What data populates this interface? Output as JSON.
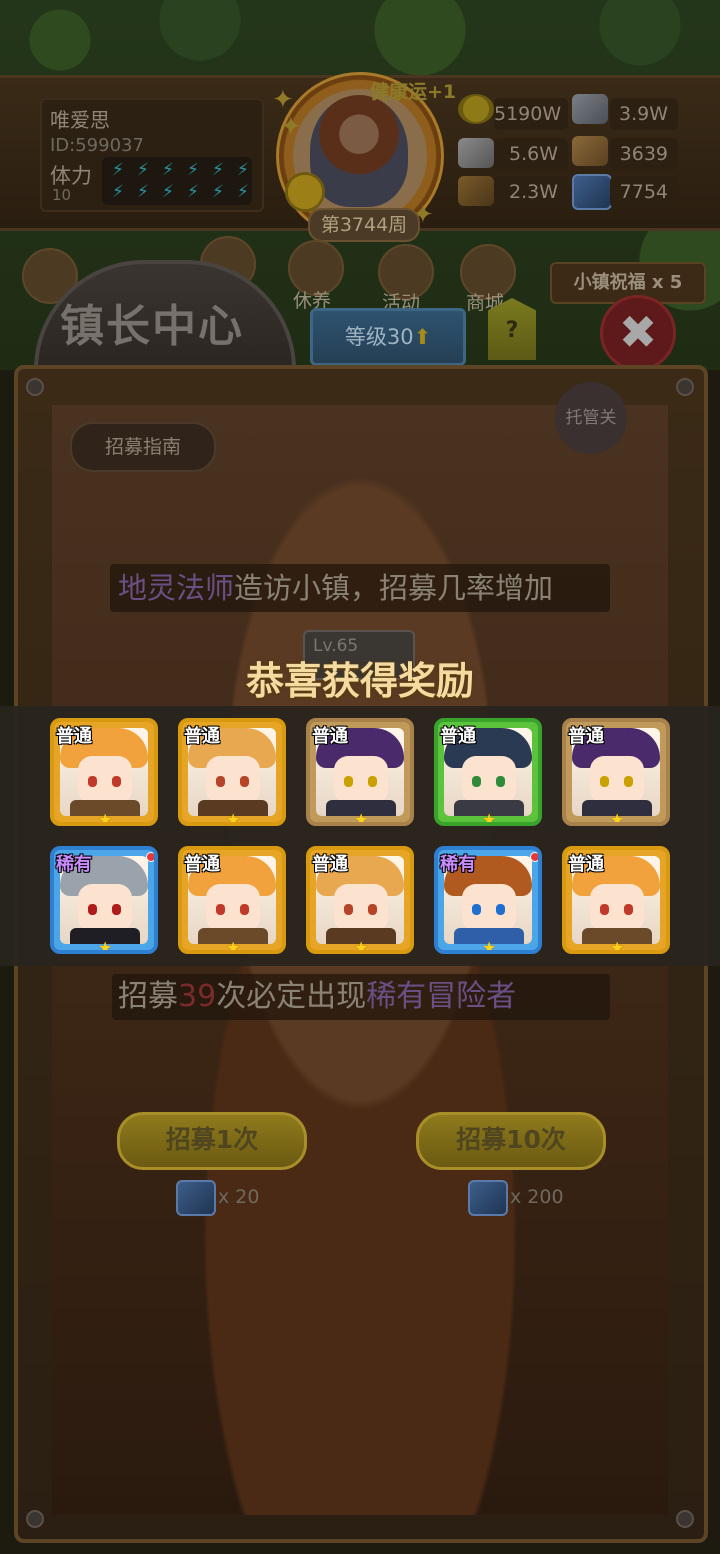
{
  "player": {
    "name": "唯爱思",
    "id": "ID:599037",
    "stamina_label": "体力",
    "stamina_value": "10",
    "stamina_bolts": 12
  },
  "portrait": {
    "buff": "健康运+1",
    "week": "第3744周"
  },
  "resources": {
    "gold": "5190W",
    "iron": "3.9W",
    "stone": "5.6W",
    "cloth": "3639",
    "wood": "2.3W",
    "gem": "7754"
  },
  "nav": {
    "rest": "休养",
    "activity": "活动",
    "shop": "商城",
    "blessing": "小镇祝福 x 5"
  },
  "mayor": {
    "title": "镇长中心",
    "level": "等级30",
    "help": "?"
  },
  "recruit": {
    "guide": "招募指南",
    "auto": "托管关",
    "visit_hero": "地灵法师",
    "visit_text": "造访小镇，招募几率增加",
    "hero_level": "Lv.65",
    "pity_prefix": "招募",
    "pity_count": "39",
    "pity_mid": "次必定出现",
    "pity_rare": "稀有冒险者",
    "once_label": "招募1次",
    "ten_label": "招募10次",
    "once_cost": "x 20",
    "ten_cost": "x 200"
  },
  "reward": {
    "title": "恭喜获得奖励",
    "cards": [
      {
        "rarity": "普通",
        "frame": "gold",
        "hair": "#f2a23c",
        "eye": "#c0392b",
        "body": "#6b4a2a",
        "stars": 1
      },
      {
        "rarity": "普通",
        "frame": "gold",
        "hair": "#e8a850",
        "eye": "#b5442a",
        "body": "#5a3a20",
        "stars": 1
      },
      {
        "rarity": "普通",
        "frame": "bronze",
        "hair": "#4a2a6a",
        "eye": "#c9a200",
        "body": "#2e2e3e",
        "stars": 1
      },
      {
        "rarity": "普通",
        "frame": "green",
        "hair": "#2a3a52",
        "eye": "#2f8a3a",
        "body": "#3a3a44",
        "stars": 1
      },
      {
        "rarity": "普通",
        "frame": "bronze",
        "hair": "#4a2a6a",
        "eye": "#c9a200",
        "body": "#2e2e3e",
        "stars": 1
      },
      {
        "rarity": "稀有",
        "frame": "blue",
        "hair": "#9aa2ab",
        "eye": "#b01c1c",
        "body": "#1e1e24",
        "stars": 1
      },
      {
        "rarity": "普通",
        "frame": "gold",
        "hair": "#f2a23c",
        "eye": "#c0392b",
        "body": "#6b4a2a",
        "stars": 1
      },
      {
        "rarity": "普通",
        "frame": "gold",
        "hair": "#e8a850",
        "eye": "#b5442a",
        "body": "#5a3a20",
        "stars": 1
      },
      {
        "rarity": "稀有",
        "frame": "blue",
        "hair": "#b05a20",
        "eye": "#1f6fd0",
        "body": "#2f5fa8",
        "stars": 1
      },
      {
        "rarity": "普通",
        "frame": "gold",
        "hair": "#f2a23c",
        "eye": "#c0392b",
        "body": "#6b4a2a",
        "stars": 1
      }
    ]
  },
  "colors": {
    "reward_title": "#f4dba0",
    "rare_text": "#c98bff",
    "star": "#ffd21c"
  }
}
